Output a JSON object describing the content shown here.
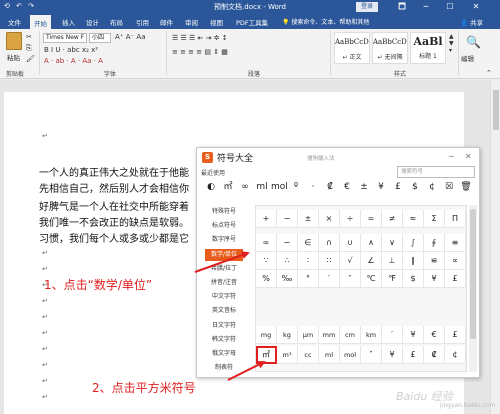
{
  "titlebar": {
    "title": "预制文档.docx - Word",
    "quick_access": "⟲ ↶ ↷",
    "login": "登录",
    "controls": [
      "🗖",
      "─",
      "☐",
      "✕"
    ]
  },
  "tabs": [
    "文件",
    "开始",
    "插入",
    "设计",
    "布局",
    "引用",
    "邮件",
    "审阅",
    "视图",
    "PDF工具集"
  ],
  "tell_me": "搜索命令、文本、帮助和其他",
  "share": "共享",
  "ribbon": {
    "paste": "粘贴",
    "clipboard": "剪贴板",
    "font_name": "Times New F",
    "font_size": "小四",
    "font_format_row": "B I U · abc x₂ x²",
    "font_color_row": "A · ab · A · Aa · A",
    "font_group": "字体",
    "paragraph_group": "段落",
    "para_row1": "☰ ☰ ☰ ⇤ ⇥ ✲ ↕",
    "para_row2": "≡ ≡ ≡ ≡ ▤ ⇕ ▦",
    "styles": [
      {
        "sample": "AaBbCcDc",
        "name": "↵ 正文"
      },
      {
        "sample": "AaBbCcDc",
        "name": "↵ 无间隔"
      },
      {
        "sample": "AaBl",
        "name": "标题 1"
      }
    ],
    "styles_group": "样式",
    "editing": "编辑"
  },
  "document": {
    "lines": [
      "一个人的真正伟大之处就在于他能",
      "先相信自己，然后别人才会相信你",
      "好脾气是一个人在社交中所能穿着",
      "我们唯一不会改正的缺点是软弱。",
      "习惯，我们每个人或多或少都是它"
    ],
    "para_mark": "↵"
  },
  "dialog": {
    "title": "符号大全",
    "subtitle": "搜狗输入法",
    "recent_label": "最近使用",
    "search_placeholder": "搜索符号",
    "logo_letter": "S",
    "ctl_min": "─",
    "ctl_close": "✕",
    "recent_symbols": [
      "◐",
      "㎡",
      "∞",
      "ml",
      "mol",
      "º",
      "·",
      "₡",
      "€",
      "±",
      "¥",
      "£",
      "$",
      "¢",
      "☒",
      "🗑"
    ],
    "categories": [
      "特殊符号",
      "标点符号",
      "数字序号",
      "数学/单位",
      "希腊/拉丁",
      "拼音/注音",
      "中文字符",
      "英文音标",
      "日文字符",
      "韩文字符",
      "俄文字母",
      "制表符"
    ],
    "selected_category": 3,
    "grid_rows": [
      [
        "+",
        "−",
        "±",
        "×",
        "÷",
        "=",
        "≠",
        "≈",
        "Σ",
        "Π"
      ],
      [
        "∞",
        "∽",
        "∈",
        "∩",
        "∪",
        "∧",
        "∨",
        "∫",
        "∮",
        "≡"
      ],
      [
        "∵",
        "∴",
        "∶",
        "∷",
        "√",
        "∠",
        "⊥",
        "∥",
        "≌",
        "∝"
      ],
      [
        "%",
        "‰",
        "°",
        "′",
        "″",
        "℃",
        "℉",
        "$",
        "¥",
        "£"
      ],
      [
        "mg",
        "kg",
        "μm",
        "mm",
        "cm",
        "km",
        "′",
        "¥",
        "€",
        "£"
      ],
      [
        "㎡",
        "m³",
        "cc",
        "ml",
        "mol",
        "″",
        "¥",
        "£",
        "₡",
        "¢"
      ]
    ],
    "highlighted_symbol": "㎡"
  },
  "annotations": {
    "step1": "1、点击“数学/单位”",
    "step2": "2、点击平方米符号"
  },
  "watermark": {
    "main": "Baidu 经验",
    "sub": "jingyan.baidu.com"
  },
  "colors": {
    "word_blue": "#2b579a",
    "sogou_orange": "#e95b1b",
    "annotation_red": "#e02020"
  }
}
